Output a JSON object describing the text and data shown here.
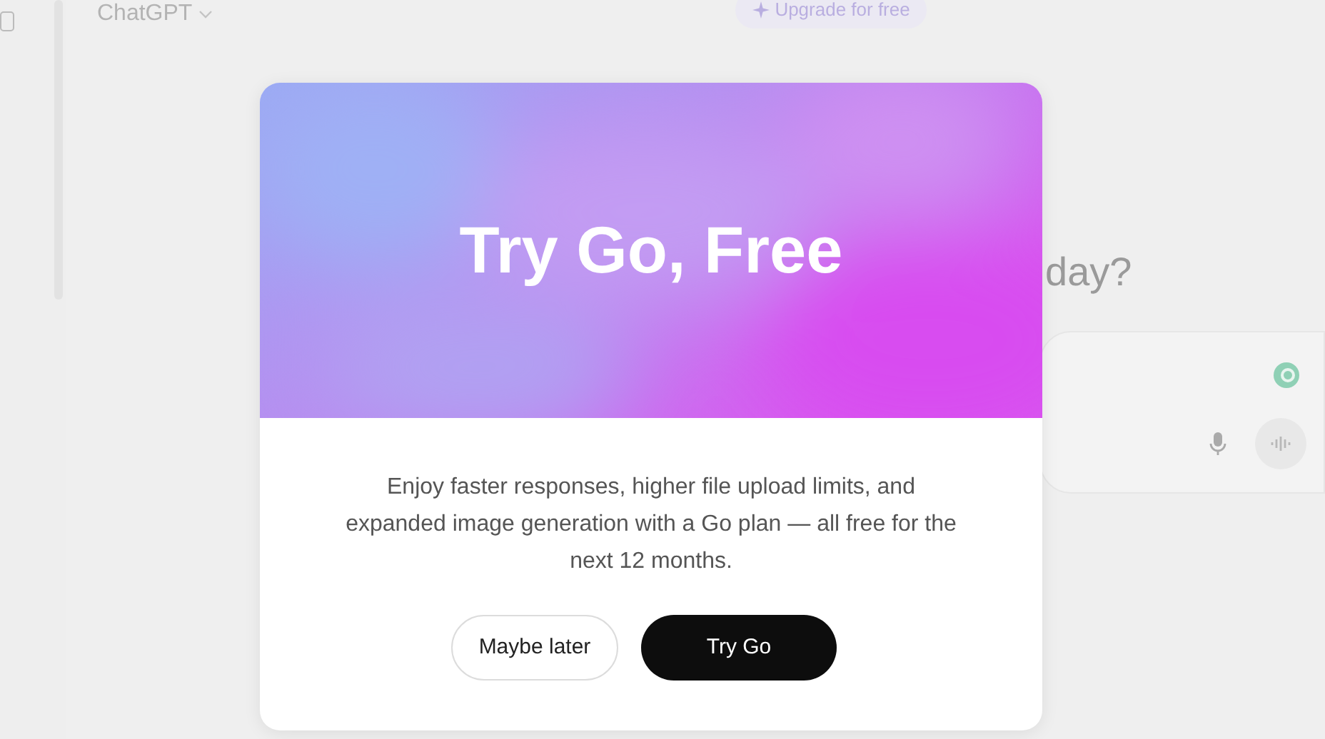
{
  "header": {
    "model": "ChatGPT",
    "upgrade": "Upgrade for free"
  },
  "greeting": "day?",
  "modal": {
    "title": "Try Go, Free",
    "body": "Enjoy faster responses, higher file upload limits, and expanded image generation with a Go plan — all free for the next 12 months.",
    "buttons": [
      {
        "label": "Maybe later",
        "kind": "secondary"
      },
      {
        "label": "Try Go",
        "kind": "primary"
      }
    ]
  }
}
